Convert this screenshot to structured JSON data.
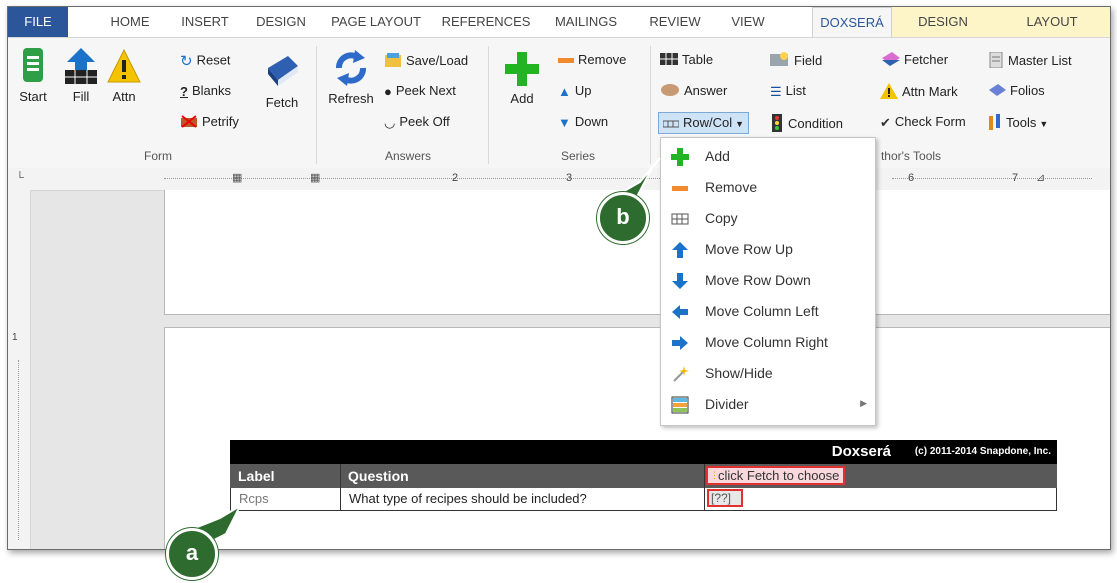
{
  "tabs": [
    {
      "label": "FILE"
    },
    {
      "label": "HOME"
    },
    {
      "label": "INSERT"
    },
    {
      "label": "DESIGN"
    },
    {
      "label": "PAGE LAYOUT"
    },
    {
      "label": "REFERENCES"
    },
    {
      "label": "MAILINGS"
    },
    {
      "label": "REVIEW"
    },
    {
      "label": "VIEW"
    },
    {
      "label": "DOXSERÁ"
    },
    {
      "label": "DESIGN"
    },
    {
      "label": "LAYOUT"
    }
  ],
  "ribbon": {
    "form": {
      "start": "Start",
      "fill": "Fill",
      "attn": "Attn",
      "reset": "Reset",
      "blanks": "Blanks",
      "petrify": "Petrify",
      "fetch": "Fetch",
      "group": "Form"
    },
    "answers": {
      "refresh": "Refresh",
      "saveload": "Save/Load",
      "peeknext": "Peek Next",
      "peekoff": "Peek Off",
      "group": "Answers"
    },
    "series": {
      "add": "Add",
      "remove": "Remove",
      "up": "Up",
      "down": "Down",
      "group": "Series"
    },
    "authors": {
      "table": "Table",
      "answer": "Answer",
      "rowcol": "Row/Col",
      "field": "Field",
      "list": "List",
      "condition": "Condition",
      "fetcher": "Fetcher",
      "attnmark": "Attn Mark",
      "checkform": "Check Form",
      "masterlist": "Master List",
      "folios": "Folios",
      "tools": "Tools",
      "group": "thor's Tools"
    }
  },
  "menu": [
    {
      "label": "Add",
      "icon": "plus-icon"
    },
    {
      "label": "Remove",
      "icon": "minus-icon"
    },
    {
      "label": "Copy",
      "icon": "copy-icon"
    },
    {
      "label": "Move Row Up",
      "icon": "arrow-up-icon"
    },
    {
      "label": "Move Row Down",
      "icon": "arrow-down-icon"
    },
    {
      "label": "Move Column Left",
      "icon": "arrow-left-icon"
    },
    {
      "label": "Move Column Right",
      "icon": "arrow-right-icon"
    },
    {
      "label": "Show/Hide",
      "icon": "wand-icon"
    },
    {
      "label": "Divider",
      "icon": "divider-icon"
    }
  ],
  "ruler": {
    "n2": "2",
    "n3": "3",
    "n6": "6",
    "n7": "7",
    "vn1": "1"
  },
  "doctable": {
    "brand": "Doxserá",
    "copyright": "(c) 2011-2014 Snapdone, Inc.",
    "headers": [
      "Label",
      "Question",
      "click Fetch to choose"
    ],
    "row": [
      "Rcps",
      "What type of recipes should be included?",
      "[??]"
    ]
  },
  "callouts": {
    "a": "a",
    "b": "b"
  },
  "colors": {
    "file_tab": "#2b579a",
    "accent_green": "#2e6b2e",
    "menu_plus": "#22b422"
  }
}
